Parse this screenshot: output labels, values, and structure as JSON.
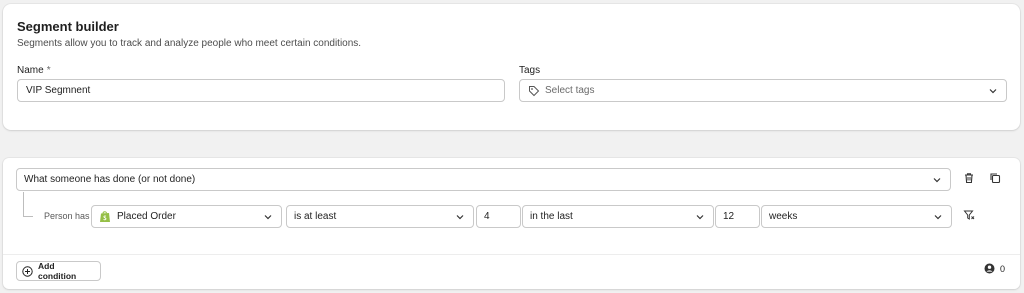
{
  "header": {
    "title": "Segment builder",
    "subtitle": "Segments allow you to track and analyze people who meet certain conditions."
  },
  "form": {
    "name_label": "Name",
    "name_required_mark": "*",
    "name_value": "VIP Segmnent",
    "tags_label": "Tags",
    "tags_placeholder": "Select tags"
  },
  "condition": {
    "type_value": "What someone has done (or not done)",
    "person_has_label": "Person has",
    "metric_value": "Placed Order",
    "metric_icon": "shopify-icon",
    "operator_value": "is at least",
    "count_value": "4",
    "timeframe_value": "in the last",
    "timeframe_amount": "12",
    "timeframe_unit": "weeks"
  },
  "footer": {
    "add_condition_label": "Add condition",
    "profile_count": "0"
  },
  "colors": {
    "shopify_green": "#95bf47",
    "border": "#c9c9c9",
    "background": "#f1f1f1"
  }
}
